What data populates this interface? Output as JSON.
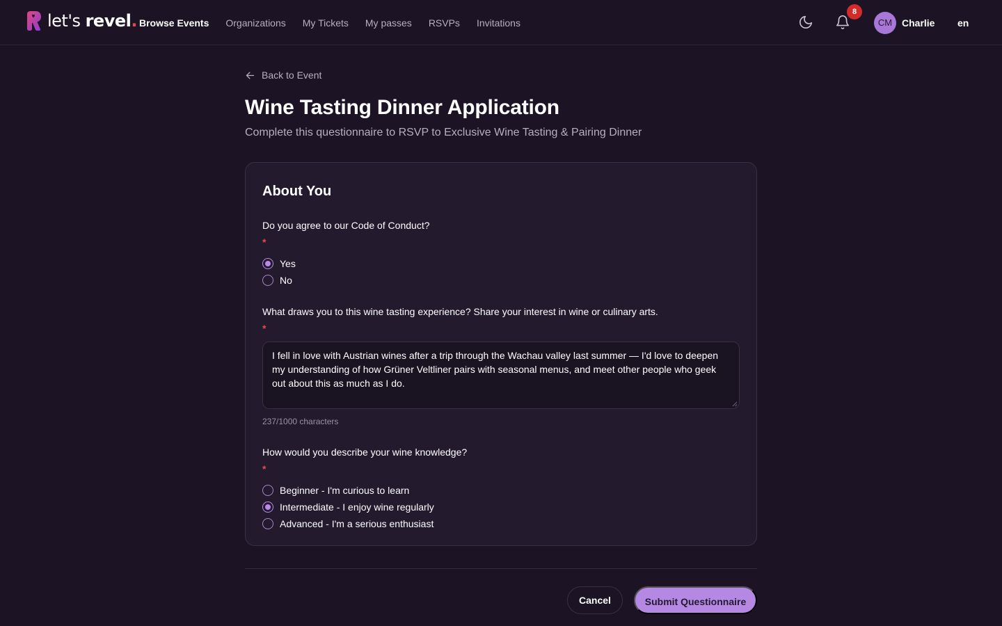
{
  "header": {
    "logo_text_thin": "let's ",
    "logo_text_bold": "revel",
    "logo_dot": ".",
    "nav": [
      {
        "label": "Browse Events",
        "active": true
      },
      {
        "label": "Organizations",
        "active": false
      },
      {
        "label": "My Tickets",
        "active": false
      },
      {
        "label": "My passes",
        "active": false
      },
      {
        "label": "RSVPs",
        "active": false
      },
      {
        "label": "Invitations",
        "active": false
      }
    ],
    "theme_icon": "moon-icon",
    "notifications_icon": "bell-icon",
    "notification_count": "8",
    "avatar_initials": "CM",
    "username": "Charlie",
    "language": "en"
  },
  "page": {
    "back_label": "Back to Event",
    "title": "Wine Tasting Dinner Application",
    "subtitle": "Complete this questionnaire to RSVP to Exclusive Wine Tasting & Pairing Dinner"
  },
  "section": {
    "title": "About You",
    "required_marker": "*",
    "q1": {
      "label": "Do you agree to our Code of Conduct?",
      "options": [
        {
          "label": "Yes",
          "selected": true
        },
        {
          "label": "No",
          "selected": false
        }
      ]
    },
    "q2": {
      "label": "What draws you to this wine tasting experience? Share your interest in wine or culinary arts.",
      "value": "I fell in love with Austrian wines after a trip through the Wachau valley last summer — I'd love to deepen my understanding of how Grüner Veltliner pairs with seasonal menus, and meet other people who geek out about this as much as I do.",
      "char_count": "237/1000 characters"
    },
    "q3": {
      "label": "How would you describe your wine knowledge?",
      "options": [
        {
          "label": "Beginner - I'm curious to learn",
          "selected": false
        },
        {
          "label": "Intermediate - I enjoy wine regularly",
          "selected": true
        },
        {
          "label": "Advanced - I'm a serious enthusiast",
          "selected": false
        }
      ]
    }
  },
  "actions": {
    "cancel_label": "Cancel",
    "submit_label": "Submit Questionnaire"
  },
  "colors": {
    "background": "#1c1424",
    "card": "#231a2e",
    "accent": "#b589e3",
    "required": "#e5484d",
    "badge": "#d22b2b"
  }
}
